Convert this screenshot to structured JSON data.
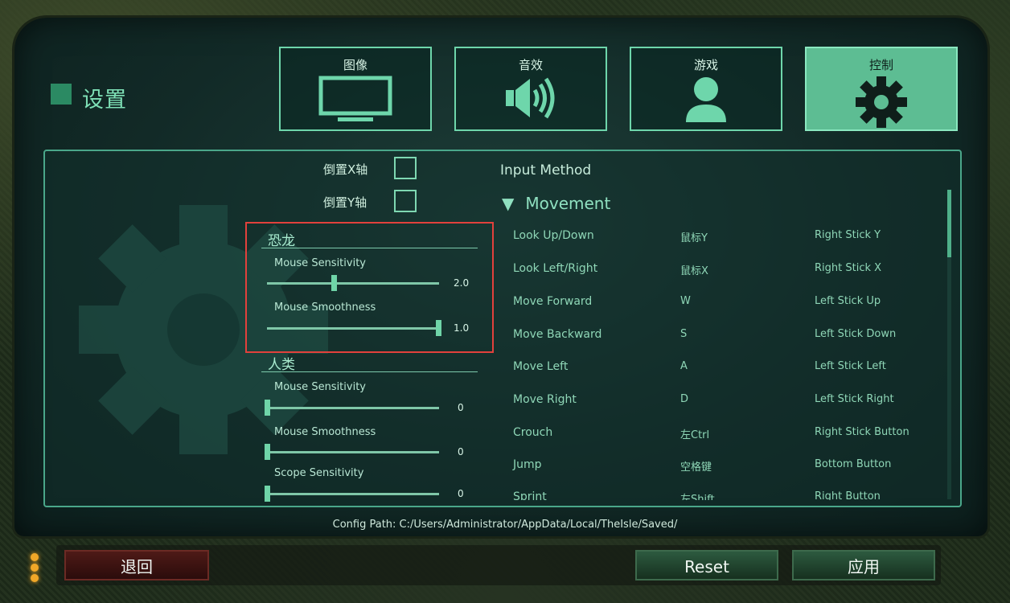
{
  "page_title": "设置",
  "tabs": [
    {
      "label": "图像",
      "icon": "monitor-icon"
    },
    {
      "label": "音效",
      "icon": "speaker-icon"
    },
    {
      "label": "游戏",
      "icon": "user-icon"
    },
    {
      "label": "控制",
      "icon": "gear-icon",
      "active": true
    }
  ],
  "checkboxes": {
    "invert_x": "倒置X轴",
    "invert_y": "倒置Y轴"
  },
  "dino_section": {
    "title": "恐龙",
    "mouse_sensitivity_label": "Mouse Sensitivity",
    "mouse_sensitivity_value": "2.0",
    "mouse_smoothness_label": "Mouse Smoothness",
    "mouse_smoothness_value": "1.0"
  },
  "human_section": {
    "title": "人类",
    "mouse_sensitivity_label": "Mouse Sensitivity",
    "mouse_sensitivity_value": "0",
    "mouse_smoothness_label": "Mouse Smoothness",
    "mouse_smoothness_value": "0",
    "scope_sensitivity_label": "Scope Sensitivity",
    "scope_sensitivity_value": "0"
  },
  "input_method": {
    "title": "Input Method",
    "group": "Movement",
    "group_arrow": "▼",
    "rows": [
      {
        "action": "Look Up/Down",
        "key": "鼠标Y",
        "pad": "Right Stick Y"
      },
      {
        "action": "Look Left/Right",
        "key": "鼠标X",
        "pad": "Right Stick X"
      },
      {
        "action": "Move Forward",
        "key": "W",
        "pad": "Left Stick Up"
      },
      {
        "action": "Move Backward",
        "key": "S",
        "pad": "Left Stick Down"
      },
      {
        "action": "Move Left",
        "key": "A",
        "pad": "Left Stick Left"
      },
      {
        "action": "Move Right",
        "key": "D",
        "pad": "Left Stick Right"
      },
      {
        "action": "Crouch",
        "key": "左Ctrl",
        "pad": "Right Stick Button"
      },
      {
        "action": "Jump",
        "key": "空格键",
        "pad": "Bottom Button"
      },
      {
        "action": "Sprint",
        "key": "左Shift",
        "pad": "Right Button"
      }
    ]
  },
  "config_path": "Config Path: C:/Users/Administrator/AppData/Local/TheIsle/Saved/",
  "buttons": {
    "back": "退回",
    "reset": "Reset",
    "apply": "应用"
  }
}
